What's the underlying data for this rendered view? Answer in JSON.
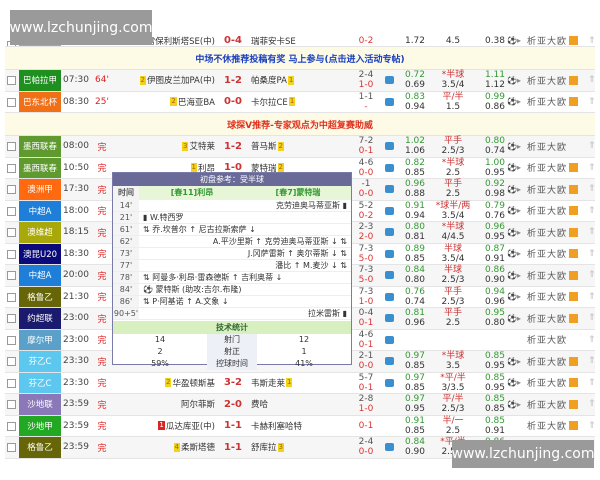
{
  "watermark": "www.lzchunjing.com",
  "links_label": "析亚大欧",
  "banners": {
    "b1": "中场不休推荐投稿有奖 马上参与(点击进入活动专帖)",
    "b2": "球探V推荐-专家观点为中超复赛助威"
  },
  "rows": [
    {
      "league": "巴西甲",
      "color": "#7ccc4c",
      "time": "07:15",
      "status": "83",
      "home": "弗雷保利斯塔SE(中)",
      "score": "0-4",
      "away": "瑞菲安卡SE",
      "c1": "",
      "c2": "0-2",
      "o1a": "",
      "o1b": "1.72",
      "h1": "",
      "h2": "4.5",
      "o2a": "",
      "o2b": "0.38",
      "icon": false,
      "play": true,
      "box": true
    },
    {
      "banner": "b1",
      "bcolor": "#1a3fbf"
    },
    {
      "league": "巴帕拉甲",
      "color": "#1f8f1f",
      "time": "07:30",
      "status": "64'",
      "hr": "2",
      "home": "伊图皮兰加PA(中)",
      "score": "1-2",
      "away": "帕桑度PA",
      "ar": "1",
      "c1": "2-4",
      "c2": "1-0",
      "o1a": "0.72",
      "o1b": "0.69",
      "h1": "*半球",
      "h2": "3.5/4",
      "o2a": "1.11",
      "o2b": "1.12",
      "icon": true,
      "play": true,
      "box": true
    },
    {
      "league": "巴东北杯",
      "color": "#f07018",
      "time": "08:30",
      "status": "25'",
      "hr": "2",
      "home": "巴海亚BA",
      "score": "0-0",
      "away": "卡尔拉CE",
      "ar": "1",
      "c1": "1-1",
      "c2": "-",
      "o1a": "0.83",
      "o1b": "0.94",
      "h1": "平/半",
      "h2": "1.5",
      "o2a": "0.99",
      "o2b": "0.86",
      "icon": true,
      "play": true,
      "box": true
    },
    {
      "banner": "b2",
      "bcolor": "#e0301e"
    },
    {
      "league": "墨西联春",
      "color": "#5f9a2e",
      "time": "08:00",
      "status": "完",
      "hr": "3",
      "home": "艾特莱",
      "score": "1-2",
      "away": "普马斯",
      "ar": "2",
      "c1": "7-2",
      "c2": "0-1",
      "o1a": "1.02",
      "o1b": "1.06",
      "h1": "平手",
      "h2": "2.5/3",
      "o2a": "0.80",
      "o2b": "0.74",
      "icon": true,
      "play": true,
      "box": false
    },
    {
      "league": "墨西联春",
      "color": "#5f9a2e",
      "time": "10:50",
      "status": "完",
      "hr": "1",
      "home": "利昂",
      "score": "1-0",
      "away": "蒙特瑞",
      "ar": "2",
      "c1": "4-6",
      "c2": "0-0",
      "o1a": "0.82",
      "o1b": "0.85",
      "h1": "*半球",
      "h2": "2.5",
      "o2a": "1.00",
      "o2b": "0.95",
      "icon": true,
      "play": true,
      "box": true
    },
    {
      "league": "澳洲甲",
      "color": "#ff6a10",
      "time": "17:30",
      "status": "完",
      "c1": "-1",
      "c2": "0-0",
      "o1a": "0.96",
      "o1b": "0.88",
      "h1": "平手",
      "h2": "2.5",
      "o2a": "0.92",
      "o2b": "0.98",
      "icon": true,
      "play": true,
      "box": true
    },
    {
      "league": "中超A",
      "color": "#1f7fd8",
      "time": "18:00",
      "status": "完",
      "c1": "5-2",
      "c2": "0-2",
      "o1a": "0.91",
      "o1b": "0.94",
      "h1": "*球半/两",
      "h2": "3.5/4",
      "o2a": "0.79",
      "o2b": "0.76",
      "icon": true,
      "play": true,
      "box": true
    },
    {
      "league": "澳维超",
      "color": "#a8a80a",
      "time": "18:15",
      "status": "完",
      "c1": "2-3",
      "c2": "2-0",
      "o1a": "0.80",
      "o1b": "0.81",
      "h1": "*半球",
      "h2": "4/4.5",
      "o2a": "0.96",
      "o2b": "0.95",
      "icon": true,
      "play": true,
      "box": true
    },
    {
      "league": "澳昆U20",
      "color": "#0a0a7a",
      "time": "18:30",
      "status": "完",
      "c1": "7-3",
      "c2": "5-0",
      "o1a": "0.89",
      "o1b": "0.85",
      "h1": "半球",
      "h2": "3.5/4",
      "o2a": "0.87",
      "o2b": "0.91",
      "icon": true,
      "play": true,
      "box": true
    },
    {
      "league": "中超A",
      "color": "#1f7fd8",
      "time": "20:00",
      "status": "完",
      "c1": "7-3",
      "c2": "5-0",
      "o1a": "0.84",
      "o1b": "0.80",
      "h1": "半球",
      "h2": "2.5/3",
      "o2a": "0.86",
      "o2b": "0.90",
      "icon": true,
      "play": true,
      "box": true
    },
    {
      "league": "格鲁乙",
      "color": "#666608",
      "time": "21:30",
      "status": "完",
      "c1": "7-3",
      "c2": "1-0",
      "o1a": "0.76",
      "o1b": "0.74",
      "h1": "平手",
      "h2": "2.5/3",
      "o2a": "0.94",
      "o2b": "0.96",
      "icon": true,
      "play": true,
      "box": true
    },
    {
      "league": "约超联",
      "color": "#1a1a6e",
      "time": "23:00",
      "status": "完",
      "c1": "0-4",
      "c2": "0-1",
      "o1a": "0.81",
      "o1b": "0.96",
      "h1": "平手",
      "h2": "2.5",
      "o2a": "0.95",
      "o2b": "0.80",
      "icon": true,
      "play": true,
      "box": true
    },
    {
      "league": "摩尔甲",
      "color": "#5aa0c8",
      "time": "23:00",
      "status": "完",
      "c1": "4-6",
      "c2": "0-1",
      "o1a": "",
      "o1b": "",
      "h1": "",
      "h2": "",
      "o2a": "",
      "o2b": "",
      "icon": true,
      "play": false,
      "box": false
    },
    {
      "league": "芬乙C",
      "color": "#5cc8f0",
      "time": "23:30",
      "status": "完",
      "c1": "2-1",
      "c2": "0-0",
      "o1a": "0.97",
      "o1b": "0.85",
      "h1": "*半球",
      "h2": "3.5",
      "o2a": "0.85",
      "o2b": "0.95",
      "icon": true,
      "play": true,
      "box": true
    },
    {
      "league": "芬乙C",
      "color": "#5cc8f0",
      "time": "23:30",
      "status": "完",
      "hr": "2",
      "home": "华盈顿斯基",
      "score": "3-2",
      "away": "韦斯走莱",
      "ar": "1",
      "c1": "5-7",
      "c2": "0-1",
      "o1a": "0.97",
      "o1b": "0.85",
      "h1": "*平/半",
      "h2": "3/3.5",
      "o2a": "0.85",
      "o2b": "0.95",
      "icon": true,
      "play": true,
      "box": true
    },
    {
      "league": "沙地联",
      "color": "#8a78b8",
      "time": "23:59",
      "status": "完",
      "home": "阿尔菲斯",
      "score": "2-0",
      "away": "费哈",
      "c1": "2-8",
      "c2": "1-0",
      "o1a": "0.97",
      "o1b": "0.95",
      "h1": "平/半",
      "h2": "2.5/3",
      "o2a": "0.85",
      "o2b": "0.85",
      "icon": false,
      "play": true,
      "box": true
    },
    {
      "league": "沙地甲",
      "color": "#22a822",
      "time": "23:59",
      "status": "完",
      "hr": "1",
      "hred": true,
      "home": "瓜达库亚(中)",
      "score": "1-1",
      "away": "卡赫利塞哈特",
      "c1": "",
      "c2": "0-1",
      "o1a": "0.91",
      "o1b": "0.85",
      "h1": "半/一",
      "h2": "2.5",
      "o2a": "0.85",
      "o2b": "0.91",
      "icon": false,
      "play": false,
      "box": true
    },
    {
      "league": "格鲁乙",
      "color": "#666608",
      "time": "23:59",
      "status": "完",
      "hr": "4",
      "home": "柔斯塔德",
      "score": "1-1",
      "away": "舒库拉",
      "ar": "3",
      "c1": "2-4",
      "c2": "0-0",
      "o1a": "0.84",
      "o1b": "0.90",
      "h1": "*平/半",
      "h2": "2.5/3",
      "o2a": "0.86",
      "o2b": "0.80",
      "icon": true,
      "play": true,
      "box": true
    }
  ],
  "popup": {
    "title": "初盘参考：受半球",
    "col_time": "时间",
    "home": "[春11]利昂",
    "away": "[春7]蒙特瑞",
    "events": [
      {
        "t": "14'",
        "home": "",
        "away": "克劳迪奥马蒂亚斯 ▮"
      },
      {
        "t": "21'",
        "home": "▮ W.特西罗",
        "away": ""
      },
      {
        "t": "61'",
        "home": "⇅ 乔.坎普尔 ↑ 尼古拉斯索萨 ↓",
        "away": ""
      },
      {
        "t": "62'",
        "home": "",
        "away": "A.平沙里斯 ↑ 克劳迪奥马蒂亚斯 ↓ ⇅"
      },
      {
        "t": "73'",
        "home": "",
        "away": "J.冈萨雷斯 ↑ 奥尔蒂斯 ↓ ⇅"
      },
      {
        "t": "77'",
        "home": "",
        "away": "潘比 ↑ M.麦沙 ↓ ⇅"
      },
      {
        "t": "78'",
        "home": "⇅ 阿曼多·利昂·雷森德斯 ↑ 吉利奥蒂 ↓",
        "away": ""
      },
      {
        "t": "84'",
        "home": "⚽ 蒙特斯 (助攻:吉尔.布隆)",
        "away": ""
      },
      {
        "t": "86'",
        "home": "⇅ P·阿基诺 ↑ A.文象 ↓",
        "away": ""
      },
      {
        "t": "90+5'",
        "home": "",
        "away": "拉米雷斯 ▮"
      }
    ],
    "stats_title": "技术统计",
    "stats": [
      {
        "h": "14",
        "label": "射门",
        "a": "12"
      },
      {
        "h": "2",
        "label": "射正",
        "a": "1"
      },
      {
        "h": "59%",
        "label": "控球时间",
        "a": "41%"
      }
    ]
  }
}
